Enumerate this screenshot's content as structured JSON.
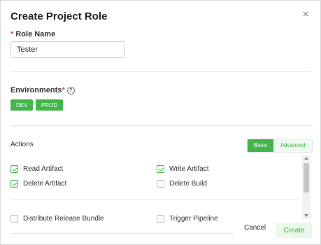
{
  "dialog": {
    "title": "Create Project Role",
    "close_icon": "close-icon"
  },
  "role_name": {
    "required_mark": "*",
    "label": "Role Name",
    "value": "Tester"
  },
  "environments": {
    "label": "Environments",
    "required_mark": "*",
    "help_icon": "question-circle-icon",
    "help_glyph": "?",
    "options": [
      "DEV",
      "PROD"
    ]
  },
  "actions": {
    "label": "Actions",
    "toggle": {
      "basic": "Basic",
      "advanced": "Advanced",
      "selected": "Basic"
    },
    "items": [
      {
        "label": "Read Artifact",
        "checked": true
      },
      {
        "label": "Write Artifact",
        "checked": true
      },
      {
        "label": "Delete Artifact",
        "checked": true
      },
      {
        "label": "Delete Build",
        "checked": false
      },
      {
        "label": "Distribute Release Bundle",
        "checked": false
      },
      {
        "label": "Trigger Pipeline",
        "checked": false
      }
    ]
  },
  "footer": {
    "cancel_label": "Cancel",
    "create_label": "Create"
  },
  "colors": {
    "accent": "#43b549",
    "required": "#e04a4a"
  }
}
